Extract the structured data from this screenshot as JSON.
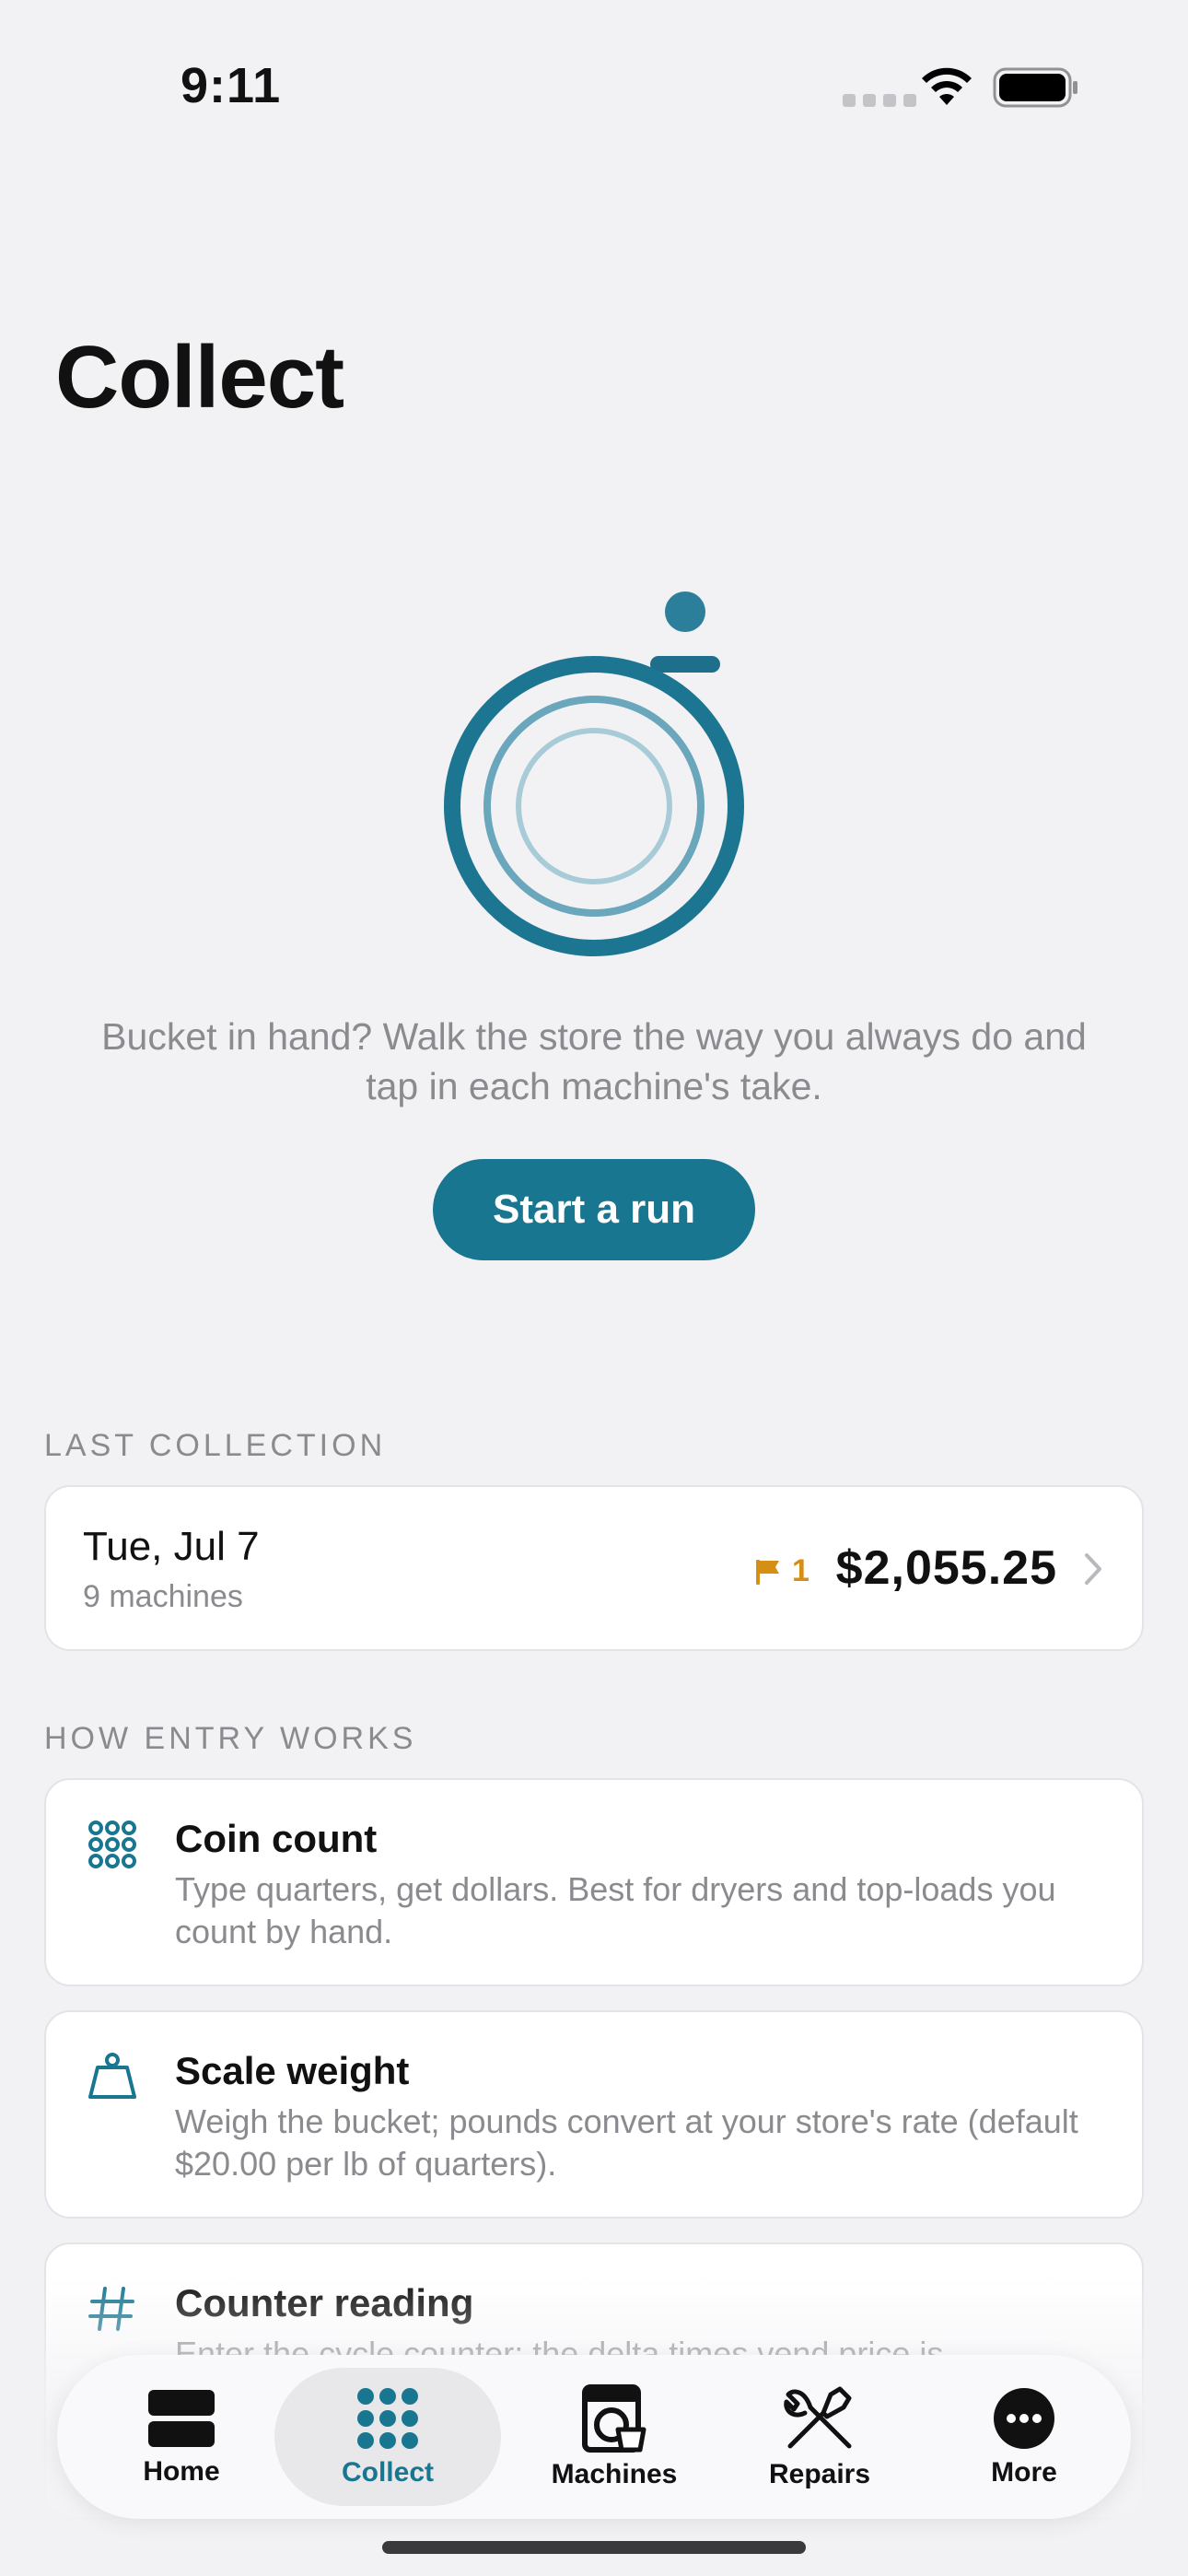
{
  "status_bar": {
    "time": "9:11"
  },
  "page": {
    "title": "Collect"
  },
  "hero": {
    "text": "Bucket in hand? Walk the store the way you always do and tap in each machine's take.",
    "button_label": "Start a run"
  },
  "last_collection": {
    "section_label": "LAST COLLECTION",
    "date": "Tue, Jul 7",
    "machines": "9 machines",
    "flag_count": "1",
    "amount": "$2,055.25"
  },
  "how_entry": {
    "section_label": "HOW ENTRY WORKS",
    "items": [
      {
        "title": "Coin count",
        "description": "Type quarters, get dollars. Best for dryers and top-loads you count by hand.",
        "icon": "coin-grid-icon"
      },
      {
        "title": "Scale weight",
        "description": "Weigh the bucket; pounds convert at your store's rate (default $20.00 per lb of quarters).",
        "icon": "scale-weight-icon"
      },
      {
        "title": "Counter reading",
        "description": "Enter the cycle counter; the delta times vend price is",
        "icon": "hash-icon"
      }
    ]
  },
  "tabs": [
    {
      "label": "Home",
      "icon": "home-icon",
      "active": false
    },
    {
      "label": "Collect",
      "icon": "collect-icon",
      "active": true
    },
    {
      "label": "Machines",
      "icon": "washer-icon",
      "active": false
    },
    {
      "label": "Repairs",
      "icon": "tools-icon",
      "active": false
    },
    {
      "label": "More",
      "icon": "more-icon",
      "active": false
    }
  ],
  "colors": {
    "accent": "#187691",
    "flag": "#d48f14",
    "background": "#f2f2f5"
  }
}
